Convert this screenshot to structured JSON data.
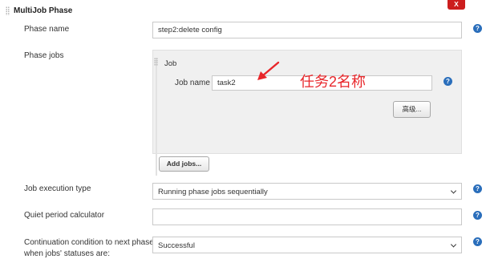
{
  "phase": {
    "title": "MultiJob Phase",
    "delete_label": "X",
    "phase_name": {
      "label": "Phase name",
      "value": "step2:delete config"
    },
    "phase_jobs": {
      "label": "Phase jobs",
      "job": {
        "section_title": "Job",
        "job_name_label": "Job name",
        "job_name_value": "task2",
        "annotation": "任务2名称",
        "advanced_button": "高级..."
      },
      "add_jobs_button": "Add jobs..."
    },
    "job_execution_type": {
      "label": "Job execution type",
      "value": "Running phase jobs sequentially"
    },
    "quiet_period": {
      "label": "Quiet period calculator",
      "value": ""
    },
    "continuation": {
      "label_line1": "Continuation condition to next phase",
      "label_line2": "when jobs' statuses are:",
      "value": "Successful"
    },
    "help_symbol": "?"
  },
  "colors": {
    "help_icon": "#2a6ebb",
    "delete_button": "#cc1e1e",
    "annotation_red": "#e8262a",
    "panel_bg": "#f0f0f0"
  }
}
